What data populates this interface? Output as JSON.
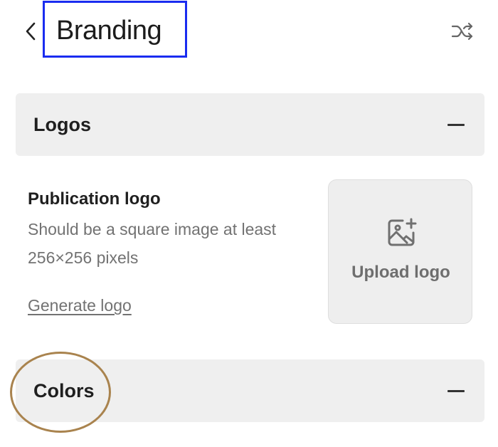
{
  "header": {
    "back_icon": "chevron-left-icon",
    "title": "Branding",
    "shuffle_icon": "shuffle-icon",
    "highlight_color": "#1a2cf0"
  },
  "sections": {
    "logos": {
      "label": "Logos",
      "toggle_icon": "minus-icon",
      "expanded": true,
      "publication_logo": {
        "title": "Publication logo",
        "description": "Should be a square image at least 256×256 pixels",
        "generate_link": "Generate logo",
        "upload_icon": "image-add-icon",
        "upload_label": "Upload logo"
      }
    },
    "colors": {
      "label": "Colors",
      "toggle_icon": "minus-icon",
      "expanded": true,
      "highlight_color": "#a9834e"
    }
  }
}
